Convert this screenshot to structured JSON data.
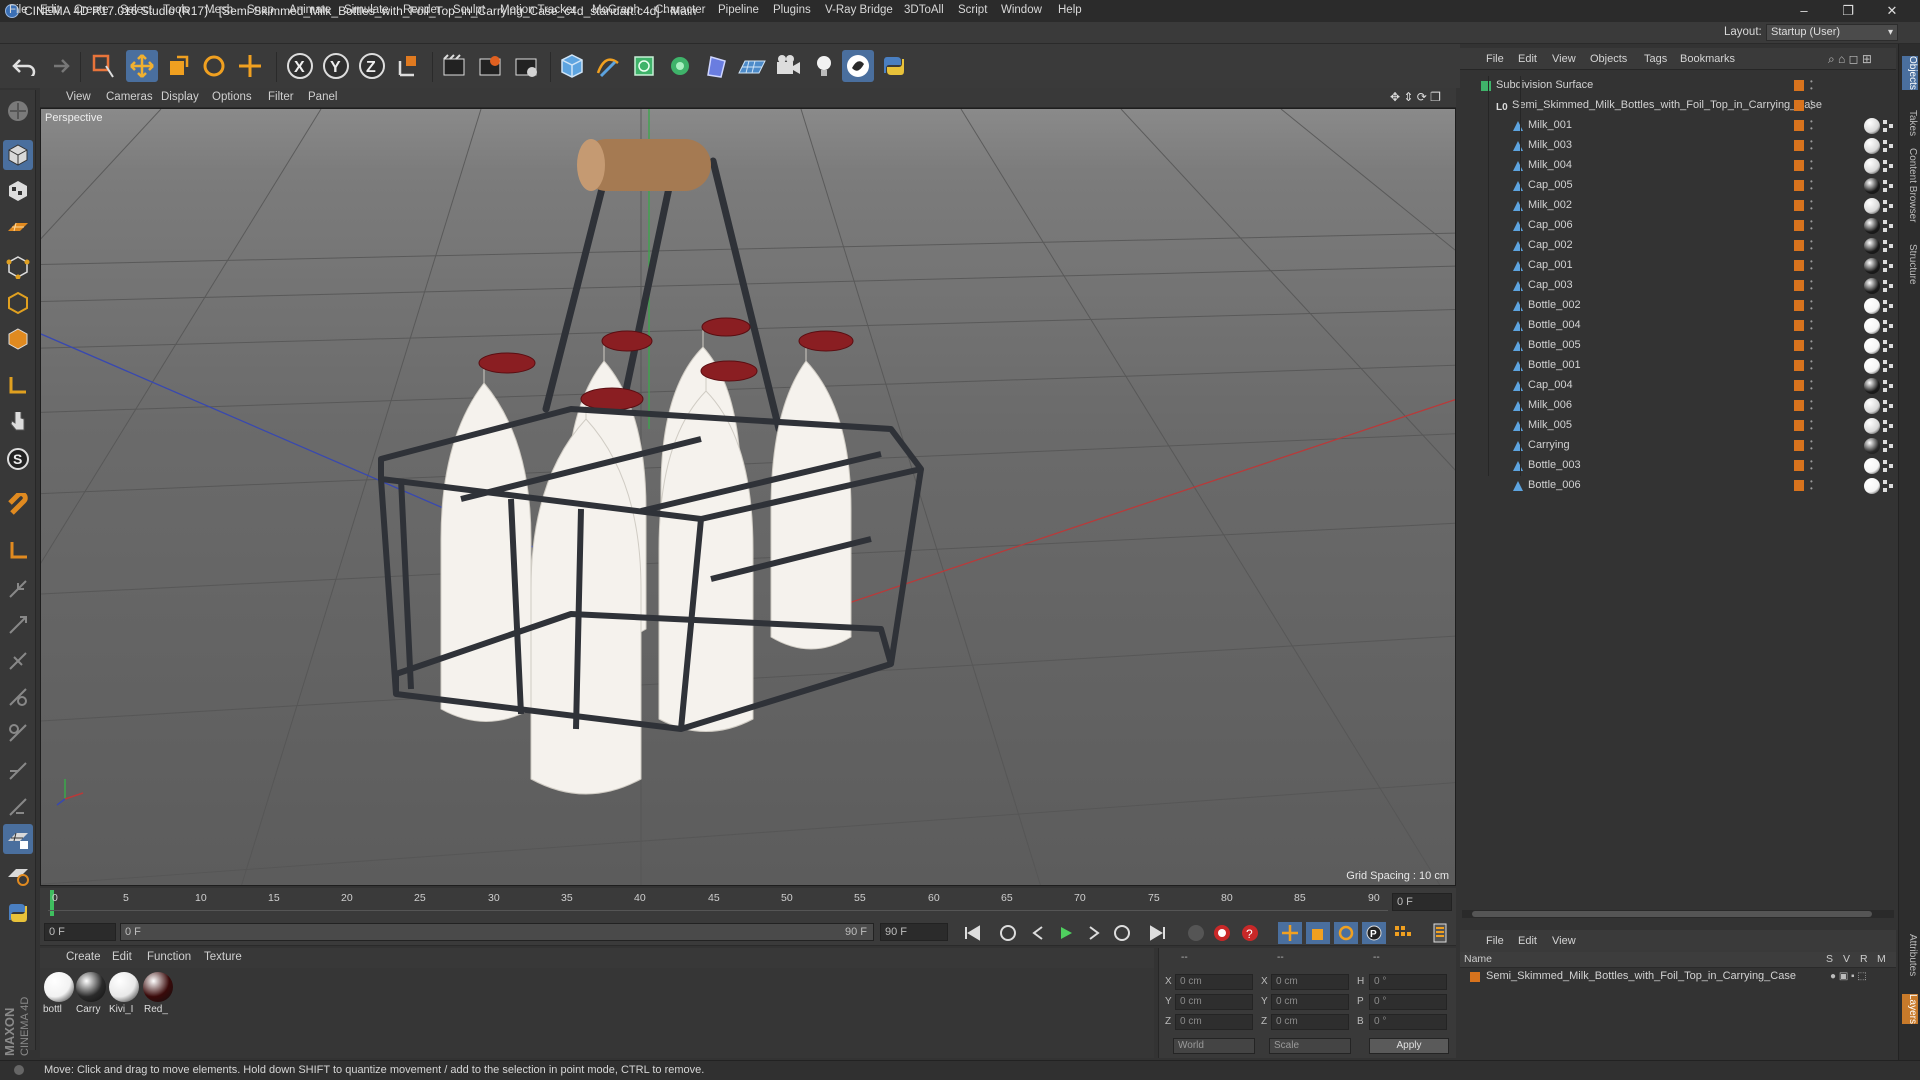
{
  "window": {
    "title": "CINEMA 4D R17.016 Studio (R17) - [Semi-Skimmed_Milk_Bottles_with_Foil_Top_in_Carrying_Case_c4d_standart.c4d] - Main",
    "minimize": "–",
    "maximize": "❐",
    "close": "✕"
  },
  "menubar": [
    "File",
    "Edit",
    "Create",
    "Select",
    "Tools",
    "Mesh",
    "Snap",
    "Animate",
    "Simulate",
    "Render",
    "Sculpt",
    "Motion Tracker",
    "MoGraph",
    "Character",
    "Pipeline",
    "Plugins",
    "V-Ray Bridge",
    "3DToAll",
    "Script",
    "Window",
    "Help"
  ],
  "layout": {
    "label": "Layout:",
    "value": "Startup (User)"
  },
  "viewport": {
    "menu": [
      "View",
      "Cameras",
      "Display",
      "Options",
      "Filter",
      "Panel"
    ],
    "camera_label": "Perspective",
    "grid_spacing": "Grid Spacing : 10 cm"
  },
  "timeline": {
    "ticks": [
      "0",
      "5",
      "10",
      "15",
      "20",
      "25",
      "30",
      "35",
      "40",
      "45",
      "50",
      "55",
      "60",
      "65",
      "70",
      "75",
      "80",
      "85",
      "90"
    ],
    "current_frame": "0 F",
    "start_field": "0 F",
    "range_start": "0 F",
    "range_end": "90 F",
    "end_field": "90 F"
  },
  "materials": {
    "menu": [
      "Create",
      "Edit",
      "Function",
      "Texture"
    ],
    "items": [
      {
        "label": "bottl",
        "color": "#f2f2f2"
      },
      {
        "label": "Carry",
        "color": "#2a2a2a"
      },
      {
        "label": "Kivi_I",
        "color": "#e8e8e8"
      },
      {
        "label": "Red_",
        "color": "#3a0a0a"
      }
    ]
  },
  "coords": {
    "rows": [
      {
        "a": "X",
        "av": "0 cm",
        "b": "X",
        "bv": "0 cm",
        "c": "H",
        "cv": "0 °"
      },
      {
        "a": "Y",
        "av": "0 cm",
        "b": "Y",
        "bv": "0 cm",
        "c": "P",
        "cv": "0 °"
      },
      {
        "a": "Z",
        "av": "0 cm",
        "b": "Z",
        "bv": "0 cm",
        "c": "B",
        "cv": "0 °"
      }
    ],
    "header_left": "--",
    "header_mid": "--",
    "header_right": "--",
    "mode1": "World",
    "mode2": "Scale",
    "apply": "Apply"
  },
  "objects": {
    "menu": [
      "File",
      "Edit",
      "View",
      "Objects",
      "Tags",
      "Bookmarks"
    ],
    "root": "Subdivision Surface",
    "group": "Semi_Skimmed_Milk_Bottles_with_Foil_Top_in_Carrying_Case",
    "items": [
      {
        "name": "Milk_001",
        "tag": "#d8d8d8"
      },
      {
        "name": "Milk_003",
        "tag": "#d8d8d8"
      },
      {
        "name": "Milk_004",
        "tag": "#d8d8d8"
      },
      {
        "name": "Cap_005",
        "tag": "#1a1a1a"
      },
      {
        "name": "Milk_002",
        "tag": "#d8d8d8"
      },
      {
        "name": "Cap_006",
        "tag": "#1a1a1a"
      },
      {
        "name": "Cap_002",
        "tag": "#1a1a1a"
      },
      {
        "name": "Cap_001",
        "tag": "#1a1a1a"
      },
      {
        "name": "Cap_003",
        "tag": "#1a1a1a"
      },
      {
        "name": "Bottle_002",
        "tag": "#f4f4f4"
      },
      {
        "name": "Bottle_004",
        "tag": "#f4f4f4"
      },
      {
        "name": "Bottle_005",
        "tag": "#f4f4f4"
      },
      {
        "name": "Bottle_001",
        "tag": "#f4f4f4"
      },
      {
        "name": "Cap_004",
        "tag": "#1a1a1a"
      },
      {
        "name": "Milk_006",
        "tag": "#d8d8d8"
      },
      {
        "name": "Milk_005",
        "tag": "#d8d8d8"
      },
      {
        "name": "Carrying",
        "tag": "#2a2a2a"
      },
      {
        "name": "Bottle_003",
        "tag": "#f4f4f4"
      },
      {
        "name": "Bottle_006",
        "tag": "#f4f4f4"
      }
    ]
  },
  "attributes": {
    "menu": [
      "File",
      "Edit",
      "View"
    ],
    "col_name": "Name",
    "cols": [
      "S",
      "V",
      "R",
      "M"
    ],
    "row": "Semi_Skimmed_Milk_Bottles_with_Foil_Top_in_Carrying_Case"
  },
  "right_tabs": [
    "Objects",
    "Takes",
    "Content Browser",
    "Structure",
    "Attributes",
    "Layers"
  ],
  "status": "Move: Click and drag to move elements. Hold down SHIFT to quantize movement / add to the selection in point mode, CTRL to remove.",
  "brand": "MAXON CINEMA 4D",
  "colors": {
    "accent": "#d8731d",
    "selection": "#4a7fc1",
    "bg": "#333333"
  }
}
